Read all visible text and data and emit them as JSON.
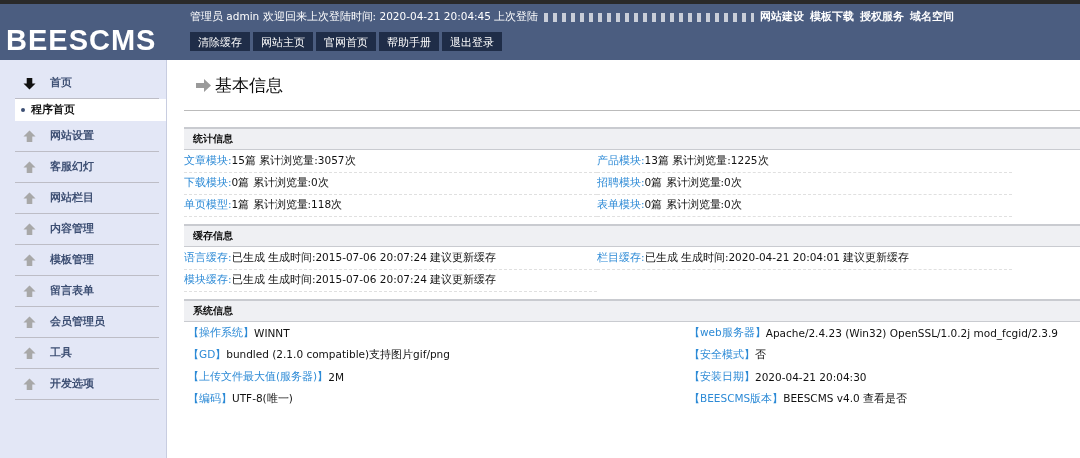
{
  "header": {
    "logo": "BEESCMS",
    "welcome": "管理员  admin  欢迎回来上次登陆时间: 2020-04-21 20:04:45  上次登陆",
    "links": [
      "网站建设",
      "模板下载",
      "授权服务",
      "域名空间"
    ],
    "buttons": [
      "清除缓存",
      "网站主页",
      "官网首页",
      "帮助手册",
      "退出登录"
    ]
  },
  "sidebar": {
    "items": [
      {
        "label": "首页",
        "expanded": true,
        "children": [
          {
            "label": "程序首页",
            "selected": true
          }
        ]
      },
      {
        "label": "网站设置",
        "expanded": false
      },
      {
        "label": "客服幻灯",
        "expanded": false
      },
      {
        "label": "网站栏目",
        "expanded": false
      },
      {
        "label": "内容管理",
        "expanded": false
      },
      {
        "label": "模板管理",
        "expanded": false
      },
      {
        "label": "留言表单",
        "expanded": false
      },
      {
        "label": "会员管理员",
        "expanded": false
      },
      {
        "label": "工具",
        "expanded": false
      },
      {
        "label": "开发选项",
        "expanded": false
      }
    ]
  },
  "page_title": "基本信息",
  "sections": [
    {
      "title": "统计信息",
      "kind": "plain",
      "rows": [
        [
          {
            "label": "文章模块:",
            "value": "15篇 累计浏览量:3057次"
          },
          {
            "label": "产品模块:",
            "value": "13篇 累计浏览量:1225次"
          }
        ],
        [
          {
            "label": "下载模块:",
            "value": "0篇 累计浏览量:0次"
          },
          {
            "label": "招聘模块:",
            "value": "0篇 累计浏览量:0次"
          }
        ],
        [
          {
            "label": "单页模型:",
            "value": "1篇 累计浏览量:118次"
          },
          {
            "label": "表单模块:",
            "value": "0篇 累计浏览量:0次"
          }
        ]
      ]
    },
    {
      "title": "缓存信息",
      "kind": "plain",
      "rows": [
        [
          {
            "label": "语言缓存:",
            "value": "已生成  生成时间:2015-07-06 20:07:24 建议更新缓存"
          },
          {
            "label": "栏目缓存:",
            "value": "已生成  生成时间:2020-04-21 20:04:01 建议更新缓存"
          }
        ],
        [
          {
            "label": "模块缓存:",
            "value": "已生成  生成时间:2015-07-06 20:07:24 建议更新缓存"
          }
        ]
      ]
    },
    {
      "title": "系统信息",
      "kind": "bracket",
      "rows": [
        [
          {
            "label": "【操作系统】",
            "value": "WINNT"
          },
          {
            "label": "【web服务器】",
            "value": "Apache/2.4.23 (Win32) OpenSSL/1.0.2j mod_fcgid/2.3.9"
          }
        ],
        [
          {
            "label": "【GD】",
            "value": "bundled (2.1.0 compatible)支持图片gif/png"
          },
          {
            "label": "【安全模式】",
            "value": "否"
          }
        ],
        [
          {
            "label": "【上传文件最大值(服务器)】",
            "value": "2M"
          },
          {
            "label": "【安装日期】",
            "value": "2020-04-21 20:04:30"
          }
        ],
        [
          {
            "label": "【编码】",
            "value": "UTF-8(唯一)"
          },
          {
            "label": "【BEESCMS版本】",
            "value": "BEESCMS v4.0  查看是否"
          }
        ]
      ]
    }
  ]
}
